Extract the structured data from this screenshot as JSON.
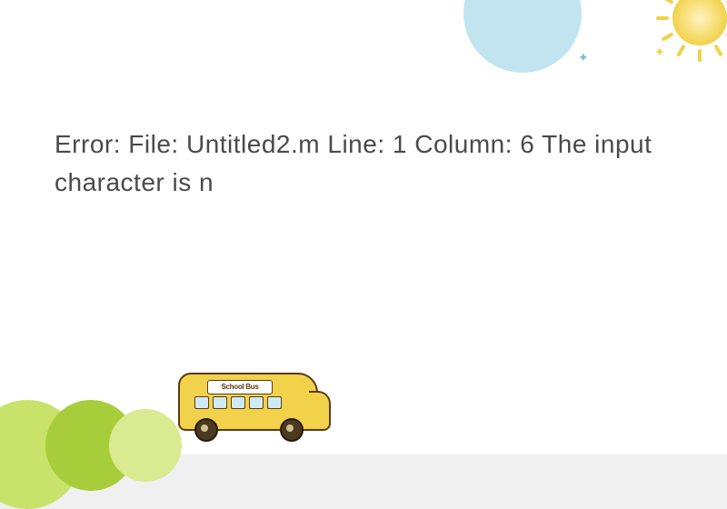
{
  "error": {
    "prefix": "Error:",
    "file_label": "File:",
    "file_name": "Untitled2.m",
    "line_label": "Line:",
    "line_no": "1",
    "column_label": "Column:",
    "column_no": "6",
    "message_fragment": "The input character is n"
  },
  "decor": {
    "bus_sign": "School Bus",
    "star_glyph": "✦"
  }
}
